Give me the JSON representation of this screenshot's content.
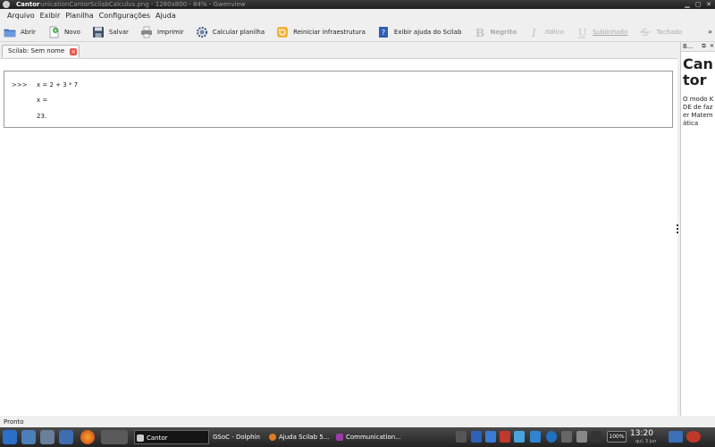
{
  "window": {
    "app_name": "Cantor",
    "subtitle": "unicationCantorScilabCalculus.png - 1280x800 - 84% - Gwenview"
  },
  "menu": [
    "Arquivo",
    "Exibir",
    "Planilha",
    "Configurações",
    "Ajuda"
  ],
  "toolbar": {
    "open": "Abrir",
    "new": "Novo",
    "save": "Salvar",
    "print": "Imprimir",
    "calculate": "Calcular planilha",
    "restart": "Reiniciar infraestrutura",
    "help": "Exibir ajuda do Scilab",
    "bold": "Negrito",
    "italic": "Itálico",
    "underline": "Sublinhado",
    "strike": "Tachado",
    "more": "»"
  },
  "tab": {
    "label": "Scilab: Sem nome",
    "close": "×"
  },
  "worksheet": {
    "prompt": ">>>",
    "command": "x = 2 + 3 * 7",
    "result_var": "x =",
    "result_value": "23."
  },
  "help_panel": {
    "header": "B...",
    "title": "Cantor",
    "text": "O modo KDE de fazer Matemática"
  },
  "status": "Pronto",
  "taskbar": {
    "tasks": [
      "Cantor",
      "GSoC - Dolphin",
      "Ajuda Scilab 5...",
      "Communication..."
    ],
    "battery": "100%",
    "clock": "13:20",
    "date": "qui, 3 jun"
  }
}
